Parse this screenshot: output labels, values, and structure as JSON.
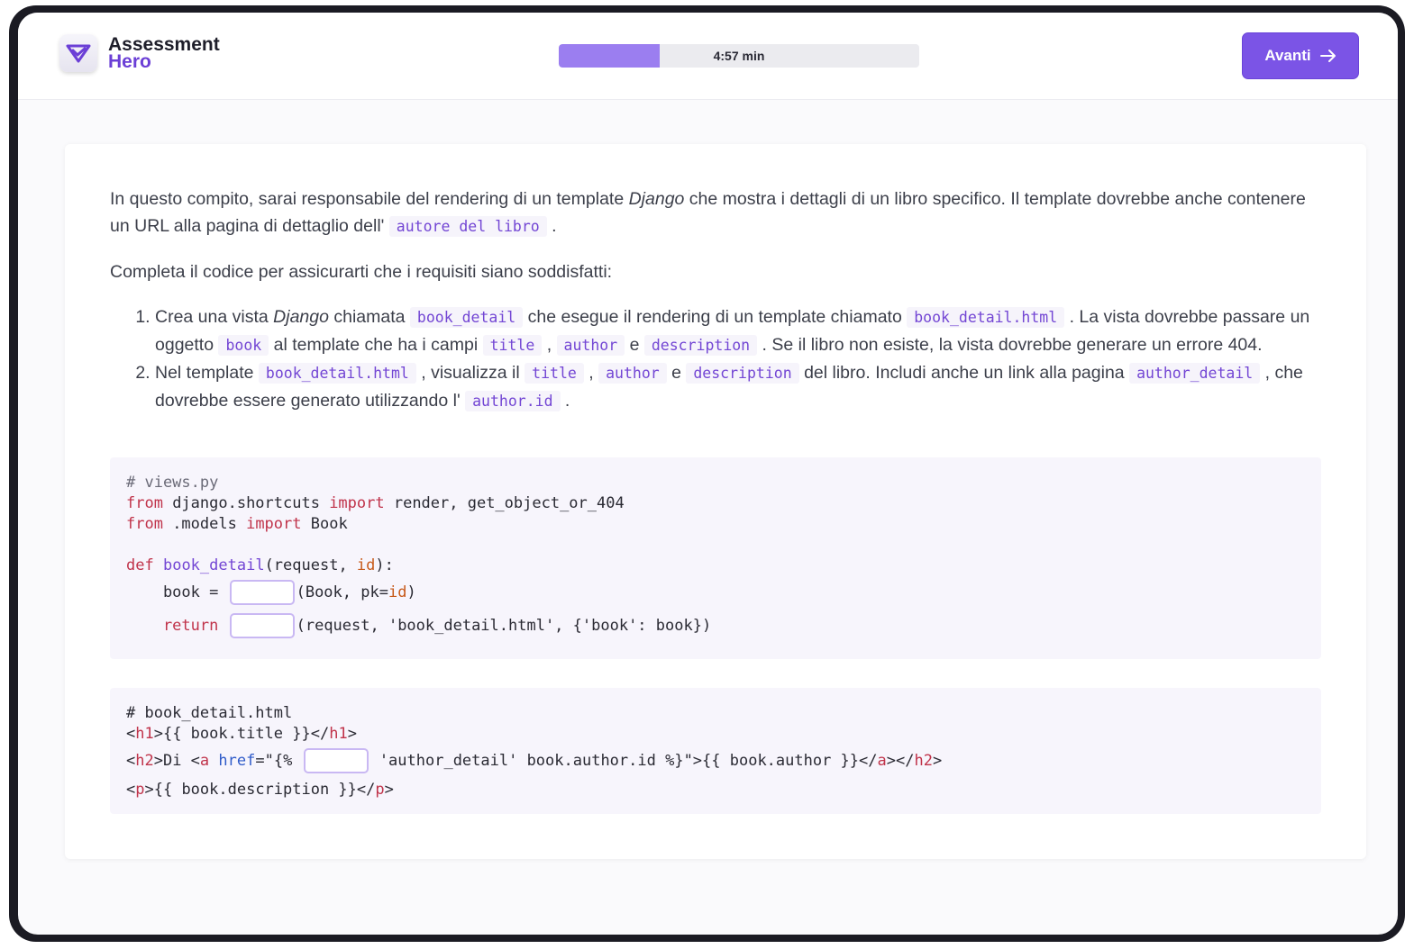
{
  "header": {
    "logo_line1": "Assessment",
    "logo_line2": "Hero",
    "timer": "4:57 min",
    "progress_fraction": 0.28,
    "next_button": "Avanti"
  },
  "colors": {
    "accent": "#7b54e6",
    "progress": "#9b7ef0",
    "code_bg": "#f7f5fc"
  },
  "intro": {
    "p1_a": "In questo compito, sarai responsabile del rendering di un template ",
    "p1_em": "Django",
    "p1_b": " che mostra i dettagli di un libro specifico. Il template dovrebbe anche contenere un URL alla pagina di dettaglio dell' ",
    "p1_code": "autore del libro",
    "p1_c": " .",
    "p2": "Completa il codice per assicurarti che i requisiti siano soddisfatti:"
  },
  "steps": {
    "s1_a": "Crea una vista ",
    "s1_em": "Django",
    "s1_b": " chiamata ",
    "s1_c1": "book_detail",
    "s1_c": " che esegue il rendering di un template chiamato ",
    "s1_c2": "book_detail.html",
    "s1_d": " . La vista dovrebbe passare un oggetto ",
    "s1_c3": "book",
    "s1_e": " al template che ha i campi ",
    "s1_c4": "title",
    "s1_f": " , ",
    "s1_c5": "author",
    "s1_g": " e ",
    "s1_c6": "description",
    "s1_h": " . Se il libro non esiste, la vista dovrebbe generare un errore 404.",
    "s2_a": "Nel template ",
    "s2_c1": "book_detail.html",
    "s2_b": " , visualizza il ",
    "s2_c2": "title",
    "s2_c": " , ",
    "s2_c3": "author",
    "s2_d": " e ",
    "s2_c4": "description",
    "s2_e": " del libro. Includi anche un link alla pagina ",
    "s2_c5": "author_detail",
    "s2_f": " , che dovrebbe essere generato utilizzando l' ",
    "s2_c6": "author.id",
    "s2_g": " ."
  },
  "code1": {
    "comment": "# views.py",
    "l2_from": "from",
    "l2_mod": " django.shortcuts ",
    "l2_import": "import",
    "l2_rest": " render, get_object_or_404",
    "l3_from": "from",
    "l3_mod": " .models ",
    "l3_import": "import",
    "l3_rest": " Book",
    "l5_def": "def",
    "l5_fn": "book_detail",
    "l5_a": "(request, ",
    "l5_id": "id",
    "l5_b": "):",
    "l6_a": "    book = ",
    "l6_b": "(Book, pk=",
    "l6_id": "id",
    "l6_c": ")",
    "l7_ret": "    return",
    "l7_b": "(request, 'book_detail.html', {'book': book})"
  },
  "code2": {
    "comment": "# book_detail.html",
    "l2_lt": "<",
    "l2_t1": "h1",
    "l2_mid": ">{{ book.title }}</",
    "l2_t2": "h1",
    "l2_gt": ">",
    "l3_lt": "<",
    "l3_t1": "h2",
    "l3_a": ">Di <",
    "l3_t2": "a",
    "l3_sp": " ",
    "l3_attr": "href",
    "l3_b": "=\"{%",
    "l3_c": " 'author_detail' book.author.id %}\">{{ book.author }}</",
    "l3_t3": "a",
    "l3_d": "></",
    "l3_t4": "h2",
    "l3_e": ">",
    "l4_lt": "<",
    "l4_t1": "p",
    "l4_mid": ">{{ book.description }}</",
    "l4_t2": "p",
    "l4_gt": ">"
  }
}
